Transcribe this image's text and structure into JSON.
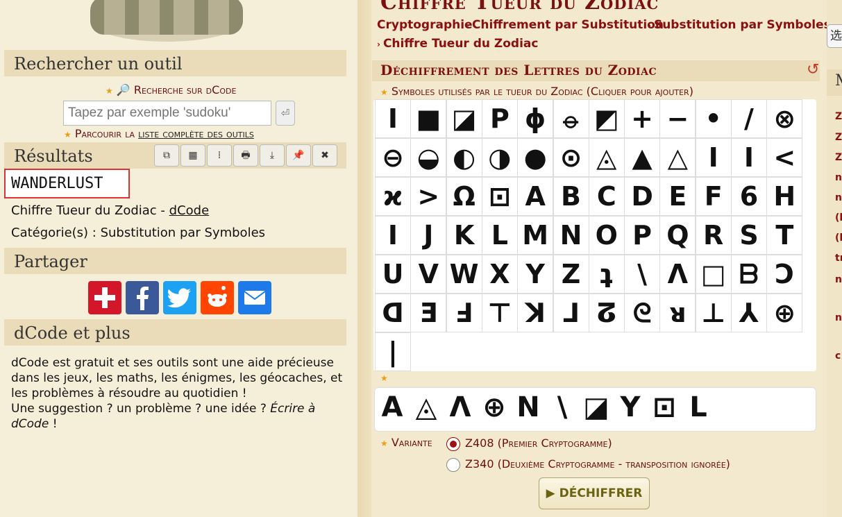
{
  "left": {
    "search": {
      "heading": "Rechercher un outil",
      "link_label": "🔎 Recherche sur dCode",
      "input_placeholder": "Tapez par exemple 'sudoku'",
      "go_label": "⏎",
      "browse_prefix": "Parcourir la",
      "browse_link": "liste complète des outils"
    },
    "results": {
      "heading": "Résultats",
      "toolbar": [
        "⧉",
        "▦",
        "⁞",
        "🖶",
        "⤓",
        "📌",
        "✖"
      ],
      "output": "WANDERLUST",
      "tool_line_prefix": "Chiffre Tueur du Zodiac - ",
      "tool_line_link": "dCode",
      "category_line": "Catégorie(s) : Substitution par Symboles"
    },
    "share": {
      "heading": "Partager",
      "icons": [
        "plus-icon",
        "facebook-icon",
        "twitter-icon",
        "reddit-icon",
        "mail-icon"
      ]
    },
    "more": {
      "heading": "dCode et plus",
      "paragraph1": "dCode est gratuit et ses outils sont une aide précieuse dans les jeux, les maths, les énigmes, les géocaches, et les problèmes à résoudre au quotidien !",
      "paragraph2_prefix": "Une suggestion ? un problème ? une idée ? ",
      "paragraph2_link": "Écrire à dCode",
      "paragraph2_suffix": " !"
    }
  },
  "main": {
    "title": "Chiffre Tueur du Zodiac",
    "breadcrumb": [
      "Cryptographie",
      "Chiffrement par Substitution",
      "Substitution par Symboles",
      "Chiffre Tueur du Zodiac"
    ],
    "panel_title": "Déchiffrement des Lettres du Zodiac",
    "symbols_label": "Symboles utilisés par le tueur du Zodiac (Cliquer pour ajouter)",
    "symbols": [
      "I",
      "■",
      "◪",
      "P",
      "ϕ",
      "⦵",
      "◩",
      "+",
      "−",
      "•",
      "/",
      "⊗",
      "⊖",
      "◒",
      "◐",
      "◑",
      "●",
      "⊙",
      "◬",
      "▲",
      "△",
      "I",
      "I",
      "<",
      "ϰ",
      ">",
      "Ω",
      "⊡",
      "A",
      "B",
      "C",
      "D",
      "E",
      "F",
      "6",
      "H",
      "I",
      "J",
      "K",
      "L",
      "M",
      "N",
      "O",
      "P",
      "Q",
      "R",
      "S",
      "T",
      "U",
      "V",
      "W",
      "X",
      "Y",
      "Z",
      "ʇ",
      "\\",
      "Λ",
      "□",
      "ᗷ",
      "Ɔ",
      "ᗡ",
      "Ǝ",
      "Ⅎ",
      "⊤",
      "ꓘ",
      "⅃",
      "ⵒ",
      "ᘓ",
      "ᴚ",
      "⊥",
      "⅄",
      "⊕",
      "|"
    ],
    "output_symbols": [
      "A",
      "◬",
      "Λ",
      "⊕",
      "N",
      "\\",
      "◪",
      "Y",
      "⊡",
      "L"
    ],
    "variant_label": "Variante",
    "variants": [
      {
        "label": "Z408 (Premier Cryptogramme)",
        "selected": true
      },
      {
        "label": "Z340 (Deuxième Cryptogramme - transposition ignorée)",
        "selected": false
      }
    ],
    "decrypt_label": "▶ DÉCHIFFRER"
  },
  "right": {
    "translate_label": "选",
    "heading_initial": "M",
    "items": [
      "Z",
      "Z",
      "Z",
      "n",
      "n",
      "(l",
      "(l",
      "tr",
      "n",
      "n",
      "c"
    ]
  },
  "colors": {
    "brand": "#7a1010",
    "accent_gold": "#e6a017",
    "result_border": "#dd3333"
  }
}
